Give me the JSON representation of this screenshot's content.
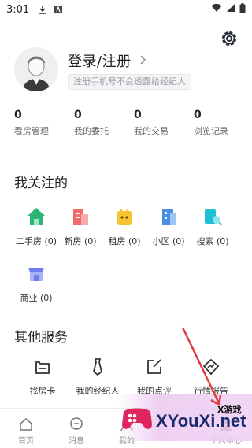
{
  "status_bar": {
    "time": "3:01"
  },
  "profile": {
    "title": "登录/注册",
    "subtitle": "注册手机号不会透露给经纪人"
  },
  "stats": [
    {
      "value": "0",
      "label": "看房管理"
    },
    {
      "value": "0",
      "label": "我的委托"
    },
    {
      "value": "0",
      "label": "我的交易"
    },
    {
      "value": "0",
      "label": "浏览记录"
    }
  ],
  "follow": {
    "title": "我关注的",
    "items": [
      {
        "label": "二手房 (0)",
        "icon": "house-icon",
        "color": "#2bb673"
      },
      {
        "label": "新房 (0)",
        "icon": "building-icon",
        "color": "#f26b6b"
      },
      {
        "label": "租房 (0)",
        "icon": "rent-bag-icon",
        "color": "#f7c531"
      },
      {
        "label": "小区 (0)",
        "icon": "community-icon",
        "color": "#4a90e2"
      },
      {
        "label": "搜索 (0)",
        "icon": "search-folder-icon",
        "color": "#1ec0d6"
      },
      {
        "label": "商业 (0)",
        "icon": "shop-icon",
        "color": "#6f7df0"
      }
    ]
  },
  "services": {
    "title": "其他服务",
    "items": [
      {
        "label": "找房卡",
        "icon": "card-icon"
      },
      {
        "label": "我的经纪人",
        "icon": "tie-icon"
      },
      {
        "label": "我的点评",
        "icon": "edit-icon"
      },
      {
        "label": "行情报告",
        "icon": "market-report-icon"
      }
    ]
  },
  "bottom_nav": [
    {
      "label": "首页",
      "icon": "home-icon"
    },
    {
      "label": "消息",
      "icon": "message-icon"
    },
    {
      "label": "我的",
      "icon": "user-icon"
    },
    {
      "label": "个人中心",
      "icon": "profile-center-icon"
    }
  ],
  "watermark": {
    "brand": "XYouXi.net",
    "tag": "X游戏"
  }
}
